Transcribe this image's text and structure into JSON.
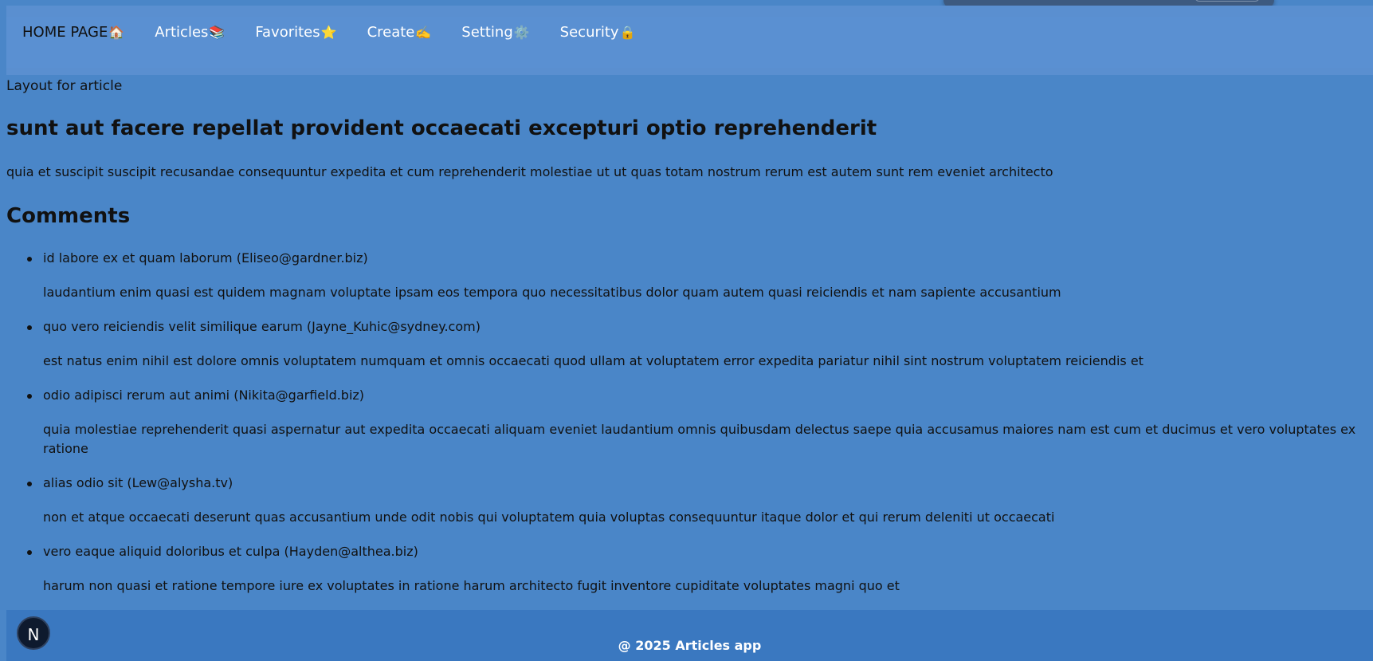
{
  "nav": {
    "items": [
      {
        "label": "HOME PAGE",
        "emoji": "🏠"
      },
      {
        "label": "Articles",
        "emoji": "📚"
      },
      {
        "label": "Favorites",
        "emoji": "⭐"
      },
      {
        "label": "Create",
        "emoji": "✍️"
      },
      {
        "label": "Setting",
        "emoji": "⚙️"
      },
      {
        "label": "Security",
        "emoji": "🔒"
      }
    ]
  },
  "layout_label": "Layout for article",
  "article": {
    "title": "sunt aut facere repellat provident occaecati excepturi optio reprehenderit",
    "body": "quia et suscipit suscipit recusandae consequuntur expedita et cum reprehenderit molestiae ut ut quas totam nostrum rerum est autem sunt rem eveniet architecto"
  },
  "comments": {
    "title": "Comments",
    "items": [
      {
        "head": "id labore ex et quam laborum (Eliseo@gardner.biz)",
        "body": "laudantium enim quasi est quidem magnam voluptate ipsam eos tempora quo necessitatibus dolor quam autem quasi reiciendis et nam sapiente accusantium"
      },
      {
        "head": "quo vero reiciendis velit similique earum (Jayne_Kuhic@sydney.com)",
        "body": "est natus enim nihil est dolore omnis voluptatem numquam et omnis occaecati quod ullam at voluptatem error expedita pariatur nihil sint nostrum voluptatem reiciendis et"
      },
      {
        "head": "odio adipisci rerum aut animi (Nikita@garfield.biz)",
        "body": "quia molestiae reprehenderit quasi aspernatur aut expedita occaecati aliquam eveniet laudantium omnis quibusdam delectus saepe quia accusamus maiores nam est cum et ducimus et vero voluptates ex ratione"
      },
      {
        "head": "alias odio sit (Lew@alysha.tv)",
        "body": "non et atque occaecati deserunt quas accusantium unde odit nobis qui voluptatem quia voluptas consequuntur itaque dolor et qui rerum deleniti ut occaecati"
      },
      {
        "head": "vero eaque aliquid doloribus et culpa (Hayden@althea.biz)",
        "body": "harum non quasi et ratione tempore iure ex voluptates in ratione harum architecto fugit inventore cupiditate voluptates magni quo et"
      }
    ]
  },
  "footer": {
    "text": "@ 2025 Articles app"
  },
  "badge": {
    "letter": "N"
  },
  "colors": {
    "background": "#4a86c8",
    "nav": "#5a90d2",
    "footer": "#3a78c0",
    "badge": "#0e1a2e"
  }
}
